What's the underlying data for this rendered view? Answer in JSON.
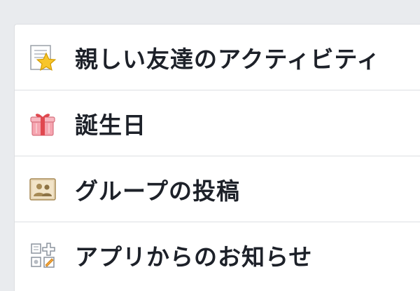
{
  "menu": {
    "items": [
      {
        "label": "親しい友達のアクティビティ",
        "icon": "star-note-icon"
      },
      {
        "label": "誕生日",
        "icon": "gift-icon"
      },
      {
        "label": "グループの投稿",
        "icon": "group-people-icon"
      },
      {
        "label": "アプリからのお知らせ",
        "icon": "apps-icon"
      }
    ]
  }
}
